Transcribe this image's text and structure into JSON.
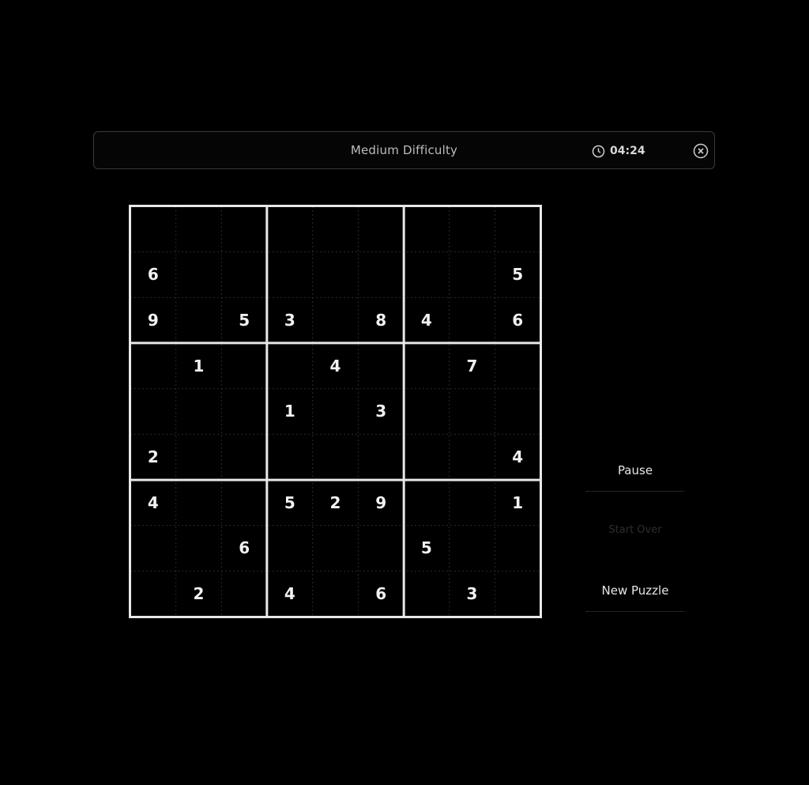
{
  "header": {
    "title": "Medium Difficulty",
    "timer": "04:24",
    "clock_icon": "clock-icon",
    "close_icon": "close-icon"
  },
  "board": {
    "rows": [
      [
        "",
        "",
        "",
        "",
        "",
        "",
        "",
        "",
        ""
      ],
      [
        "6",
        "",
        "",
        "",
        "",
        "",
        "",
        "",
        "5"
      ],
      [
        "9",
        "",
        "5",
        "3",
        "",
        "8",
        "4",
        "",
        "6"
      ],
      [
        "",
        "1",
        "",
        "",
        "4",
        "",
        "",
        "7",
        ""
      ],
      [
        "",
        "",
        "",
        "1",
        "",
        "3",
        "",
        "",
        ""
      ],
      [
        "2",
        "",
        "",
        "",
        "",
        "",
        "",
        "",
        "4"
      ],
      [
        "4",
        "",
        "",
        "5",
        "2",
        "9",
        "",
        "",
        "1"
      ],
      [
        "",
        "",
        "6",
        "",
        "",
        "",
        "5",
        "",
        ""
      ],
      [
        "",
        "2",
        "",
        "4",
        "",
        "6",
        "",
        "3",
        ""
      ]
    ]
  },
  "sidebar": {
    "pause_label": "Pause",
    "faded_label": "Start Over",
    "new_puzzle_label": "New Puzzle"
  },
  "colors": {
    "background": "#000000",
    "grid_major": "#e8e8e8",
    "grid_minor": "#2a2a2a",
    "text": "#f2f2f2"
  }
}
